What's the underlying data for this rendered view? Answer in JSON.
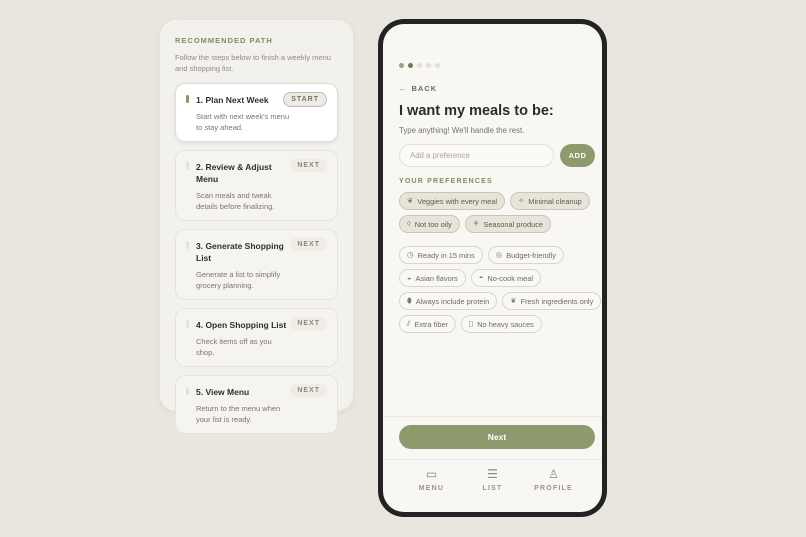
{
  "path": {
    "title": "RECOMMENDED PATH",
    "subtitle": "Follow the steps below to finish a weekly menu and shopping list.",
    "steps": [
      {
        "title": "1. Plan Next Week",
        "desc": "Start with next week's menu to stay ahead.",
        "badge": "START"
      },
      {
        "title": "2. Review & Adjust Menu",
        "desc": "Scan meals and tweak details before finalizing.",
        "badge": "NEXT"
      },
      {
        "title": "3. Generate Shopping List",
        "desc": "Generate a list to simplify grocery planning.",
        "badge": "NEXT"
      },
      {
        "title": "4. Open Shopping List",
        "desc": "Check items off as you shop.",
        "badge": "NEXT"
      },
      {
        "title": "5. View Menu",
        "desc": "Return to the menu when your list is ready.",
        "badge": "NEXT"
      }
    ]
  },
  "onboarding": {
    "back_label": "BACK",
    "heading": "I want my meals to be:",
    "subheading": "Type anything! We'll handle the rest.",
    "input_placeholder": "Add a preference",
    "add_label": "ADD",
    "preferences_label": "YOUR PREFERENCES",
    "selected": [
      {
        "label": "Veggies with every meal",
        "icon": "leaf-icon"
      },
      {
        "label": "Minimal cleanup",
        "icon": "sparkle-icon"
      },
      {
        "label": "Not too oily",
        "icon": "drop-icon"
      },
      {
        "label": "Seasonal produce",
        "icon": "sprout-icon"
      }
    ],
    "suggestions": [
      {
        "label": "Ready in 15 mins",
        "icon": "timer-icon"
      },
      {
        "label": "Budget-friendly",
        "icon": "coins-icon"
      },
      {
        "label": "Asian flavors",
        "icon": "bowl-icon"
      },
      {
        "label": "No-cook meal",
        "icon": "salad-icon"
      },
      {
        "label": "Always include protein",
        "icon": "egg-icon"
      },
      {
        "label": "Fresh ingredients only",
        "icon": "leaf-icon"
      },
      {
        "label": "Extra fiber",
        "icon": "grain-icon"
      },
      {
        "label": "No heavy sauces",
        "icon": "jar-icon"
      }
    ],
    "next_label": "Next",
    "nav": [
      {
        "label": "MENU",
        "icon": "book-icon"
      },
      {
        "label": "LIST",
        "icon": "checklist-icon"
      },
      {
        "label": "PROFILE",
        "icon": "user-icon"
      }
    ]
  },
  "colors": {
    "accent": "#8f9a6c",
    "label_green": "#7f8d63",
    "background": "#e9e6e0"
  }
}
